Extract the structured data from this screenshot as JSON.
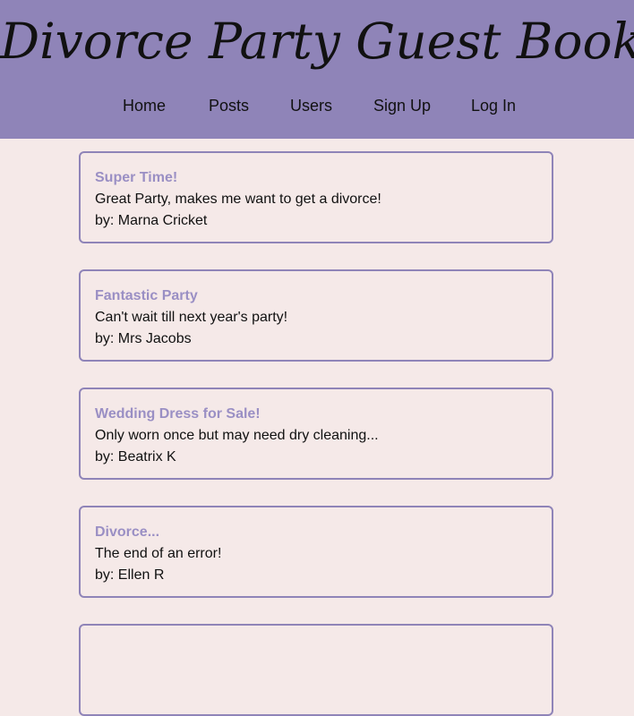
{
  "header": {
    "title": "Divorce Party Guest Book",
    "nav": [
      "Home",
      "Posts",
      "Users",
      "Sign Up",
      "Log In"
    ]
  },
  "posts": [
    {
      "title": "Super Time!",
      "body": "Great Party, makes me want to get a divorce!",
      "author": "by: Marna Cricket"
    },
    {
      "title": "Fantastic Party",
      "body": "Can't wait till next year's party!",
      "author": "by: Mrs Jacobs"
    },
    {
      "title": "Wedding Dress for Sale!",
      "body": "Only worn once but may need dry cleaning...",
      "author": "by: Beatrix K"
    },
    {
      "title": "Divorce...",
      "body": "The end of an error!",
      "author": "by: Ellen R"
    },
    {
      "title": "",
      "body": "",
      "author": ""
    }
  ],
  "colors": {
    "header_bg": "#8f84b8",
    "page_bg": "#f5e9e8",
    "accent": "#9a8fc4"
  }
}
